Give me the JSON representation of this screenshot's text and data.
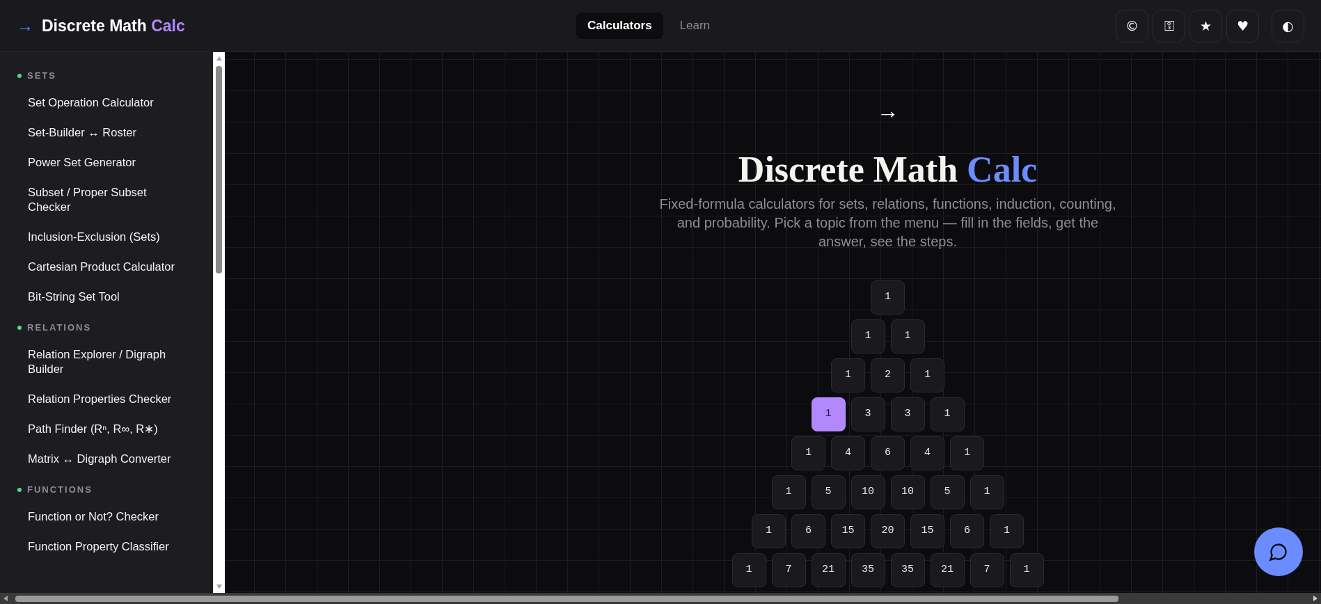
{
  "header": {
    "logo_arrow": "→",
    "title": "Discrete Math",
    "title_accent": "Calc"
  },
  "nav": [
    {
      "label": "Calculators",
      "selected": true
    },
    {
      "label": "Learn",
      "selected": false
    }
  ],
  "toolbar": [
    "©",
    "⚿",
    "★",
    "♥",
    "◐"
  ],
  "sidebar": {
    "sections": [
      {
        "title": "SETS",
        "color": "#4ade80",
        "items": [
          {
            "label": "Set Operation Calculator"
          },
          {
            "label": "Set-Builder ↔ Roster"
          },
          {
            "label": "Power Set Generator"
          },
          {
            "label": "Subset / Proper Subset Checker"
          },
          {
            "label": "Inclusion-Exclusion (Sets)"
          },
          {
            "label": "Cartesian Product Calculator"
          },
          {
            "label": "Bit-String Set Tool"
          }
        ]
      },
      {
        "title": "RELATIONS",
        "color": "#4ade80",
        "items": [
          {
            "label": "Relation Explorer / Digraph Builder"
          },
          {
            "label": "Relation Properties Checker"
          },
          {
            "label": "Path Finder (Rⁿ, R∞, R∗)"
          },
          {
            "label": "Matrix ↔ Digraph Converter"
          }
        ]
      },
      {
        "title": "FUNCTIONS",
        "color": "#4ade80",
        "items": [
          {
            "label": "Function or Not? Checker"
          },
          {
            "label": "Function Property Classifier"
          }
        ]
      }
    ]
  },
  "hero": {
    "arrow": "→",
    "title": "Discrete Math",
    "title_accent": "Calc",
    "subtitle": "Fixed-formula calculators for sets, relations, functions, induction, counting, and probability. Pick a topic from the menu — fill in the fields, get the answer, see the steps."
  },
  "triangle": [
    [
      {
        "value": "1",
        "selected": false
      }
    ],
    [
      {
        "value": "1",
        "selected": false
      },
      {
        "value": "1",
        "selected": false
      }
    ],
    [
      {
        "value": "1",
        "selected": false
      },
      {
        "value": "2",
        "selected": false
      },
      {
        "value": "1",
        "selected": false
      }
    ],
    [
      {
        "value": "1",
        "selected": true
      },
      {
        "value": "3",
        "selected": false
      },
      {
        "value": "3",
        "selected": false
      },
      {
        "value": "1",
        "selected": false
      }
    ],
    [
      {
        "value": "1",
        "selected": false
      },
      {
        "value": "4",
        "selected": false
      },
      {
        "value": "6",
        "selected": false
      },
      {
        "value": "4",
        "selected": false
      },
      {
        "value": "1",
        "selected": false
      }
    ],
    [
      {
        "value": "1",
        "selected": false
      },
      {
        "value": "5",
        "selected": false
      },
      {
        "value": "10",
        "selected": false
      },
      {
        "value": "10",
        "selected": false
      },
      {
        "value": "5",
        "selected": false
      },
      {
        "value": "1",
        "selected": false
      }
    ],
    [
      {
        "value": "1",
        "selected": false
      },
      {
        "value": "6",
        "selected": false
      },
      {
        "value": "15",
        "selected": false
      },
      {
        "value": "20",
        "selected": false
      },
      {
        "value": "15",
        "selected": false
      },
      {
        "value": "6",
        "selected": false
      },
      {
        "value": "1",
        "selected": false
      }
    ],
    [
      {
        "value": "1",
        "selected": false
      },
      {
        "value": "7",
        "selected": false
      },
      {
        "value": "21",
        "selected": false
      },
      {
        "value": "35",
        "selected": false
      },
      {
        "value": "35",
        "selected": false
      },
      {
        "value": "21",
        "selected": false
      },
      {
        "value": "7",
        "selected": false
      },
      {
        "value": "1",
        "selected": false
      }
    ]
  ]
}
